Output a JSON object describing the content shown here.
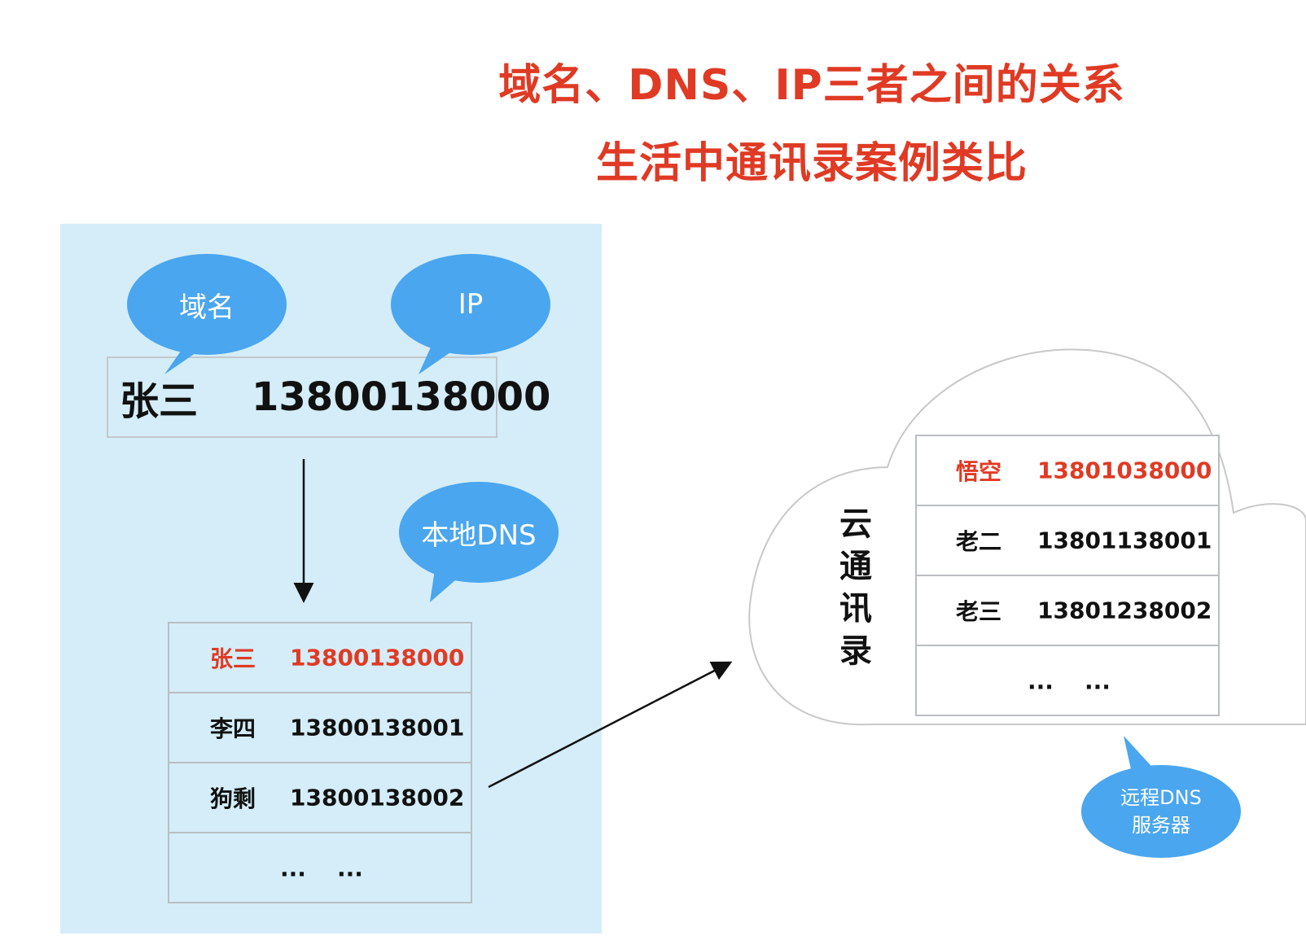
{
  "titles": {
    "main": "域名、DNS、IP三者之间的关系",
    "sub": "生活中通讯录案例类比"
  },
  "bubbles": {
    "domain": "域名",
    "ip": "IP",
    "local_dns": "本地DNS",
    "remote_dns_line1": "远程DNS",
    "remote_dns_line2": "服务器"
  },
  "record": {
    "name": "张三",
    "phone": "13800138000"
  },
  "local_table": {
    "rows": [
      {
        "name": "张三",
        "phone": "13800138000",
        "highlight": true
      },
      {
        "name": "李四",
        "phone": "13800138001",
        "highlight": false
      },
      {
        "name": "狗剩",
        "phone": "13800138002",
        "highlight": false
      },
      {
        "name": "...",
        "phone": "...",
        "highlight": false
      }
    ]
  },
  "cloud": {
    "label": "云通讯录",
    "rows": [
      {
        "name": "悟空",
        "phone": "13801038000",
        "highlight": true
      },
      {
        "name": "老二",
        "phone": "13801138001",
        "highlight": false
      },
      {
        "name": "老三",
        "phone": "13801238002",
        "highlight": false
      },
      {
        "name": "...",
        "phone": "...",
        "highlight": false
      }
    ]
  },
  "colors": {
    "title": "#e03a24",
    "bubble": "#4aa6ee",
    "panel": "#d4edf8",
    "highlight": "#e03a24"
  }
}
